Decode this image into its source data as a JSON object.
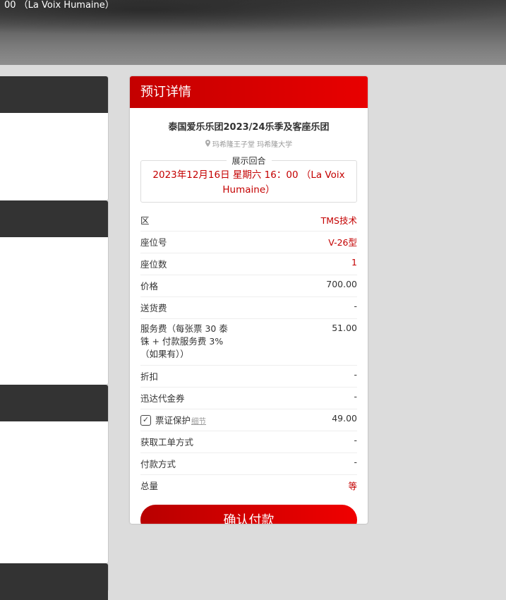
{
  "top_banner": {
    "cut_text": "00 （La Voix Humaine）"
  },
  "booking": {
    "header": "预订详情",
    "event_title": "泰国爱乐乐团2023/24乐季及客座乐团",
    "venue": "玛希隆王子堂 玛希隆大学",
    "round_label": "展示回合",
    "round_value": "2023年12月16日 星期六 16：00 （La Voix Humaine）",
    "rows": [
      {
        "label": "区",
        "value": "TMS技术"
      },
      {
        "label": "座位号",
        "value": "V-26型"
      },
      {
        "label": "座位数",
        "value": "1"
      },
      {
        "label": "价格",
        "value": "700.00"
      },
      {
        "label": "送货费",
        "value": "-"
      },
      {
        "label": "服务费（每张票 30 泰铢 + 付款服务费 3%（如果有））",
        "value": "51.00"
      },
      {
        "label": "折扣",
        "value": "-"
      },
      {
        "label": "迅达代金券",
        "value": "-"
      },
      {
        "label": "票证保护",
        "link": "细节",
        "value": "49.00"
      },
      {
        "label": "获取工单方式",
        "value": "-"
      },
      {
        "label": "付款方式",
        "value": "-"
      },
      {
        "label": "总量",
        "value": "等"
      }
    ],
    "confirm_label": "确认付款"
  },
  "colors": {
    "accent": "#c40000",
    "dark_header": "#333333",
    "background": "#dcdcdc"
  },
  "icons": {
    "venue": "map-pin-icon",
    "checkbox": "checkmark-icon"
  }
}
